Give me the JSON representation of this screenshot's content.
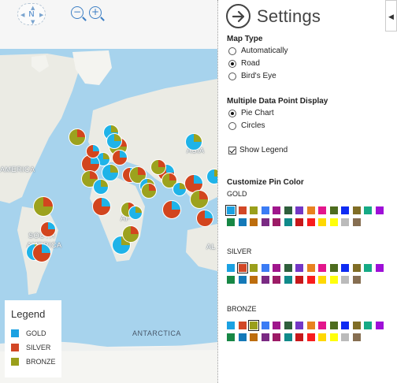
{
  "map": {
    "labels": {
      "asia": "ASIA",
      "north_america": "AMERICA",
      "south_america_1": "SOUTH",
      "south_america_2": "AMERICA",
      "africa": "AF",
      "antarctica": "ANTARCTICA",
      "australia": "AL"
    },
    "compass_label": "N",
    "zoom_out_icon": "zoom-out-icon",
    "zoom_in_icon": "zoom-in-icon",
    "colors": {
      "ocean": "#a7d3ed",
      "land": "#ebebe4",
      "gold": "#1fb3e8",
      "silver": "#d2451e",
      "bronze": "#9ca21e"
    }
  },
  "legend": {
    "title": "Legend",
    "items": [
      {
        "label": "GOLD",
        "color": "#1ba1e2"
      },
      {
        "label": "SILVER",
        "color": "#d24726"
      },
      {
        "label": "BRONZE",
        "color": "#9a9f1b"
      }
    ]
  },
  "settings": {
    "title": "Settings",
    "back_icon": "arrow-right-circle-icon",
    "toggle_icon": "caret-left-icon",
    "map_type": {
      "heading": "Map Type",
      "options": [
        {
          "label": "Automatically",
          "selected": false
        },
        {
          "label": "Road",
          "selected": true
        },
        {
          "label": "Bird's Eye",
          "selected": false
        }
      ]
    },
    "multi_display": {
      "heading": "Multiple Data Point Display",
      "options": [
        {
          "label": "Pie Chart",
          "selected": true
        },
        {
          "label": "Circles",
          "selected": false
        }
      ]
    },
    "show_legend": {
      "label": "Show Legend",
      "checked": true
    },
    "pin_color": {
      "heading": "Customize Pin Color",
      "groups": [
        {
          "label": "GOLD",
          "selected_index": 0
        },
        {
          "label": "SILVER",
          "selected_index": 1
        },
        {
          "label": "BRONZE",
          "selected_index": 2
        }
      ],
      "palette": [
        "#1ba1e2",
        "#d24726",
        "#9a9f1b",
        "#3b7cf5",
        "#a0168c",
        "#2f5f3c",
        "#7437c5",
        "#e88220",
        "#e3168c",
        "#4d6c1e",
        "#0e2bf3",
        "#806d25",
        "#16aa85",
        "#9e0fd8",
        "#178745",
        "#1479b8",
        "#bd6d0d",
        "#7a2a83",
        "#9c1b66",
        "#108a8a",
        "#c6181b",
        "#f81c1e",
        "#ffd802",
        "#ffff0b",
        "#bbbbbb",
        "#866e51"
      ]
    }
  }
}
